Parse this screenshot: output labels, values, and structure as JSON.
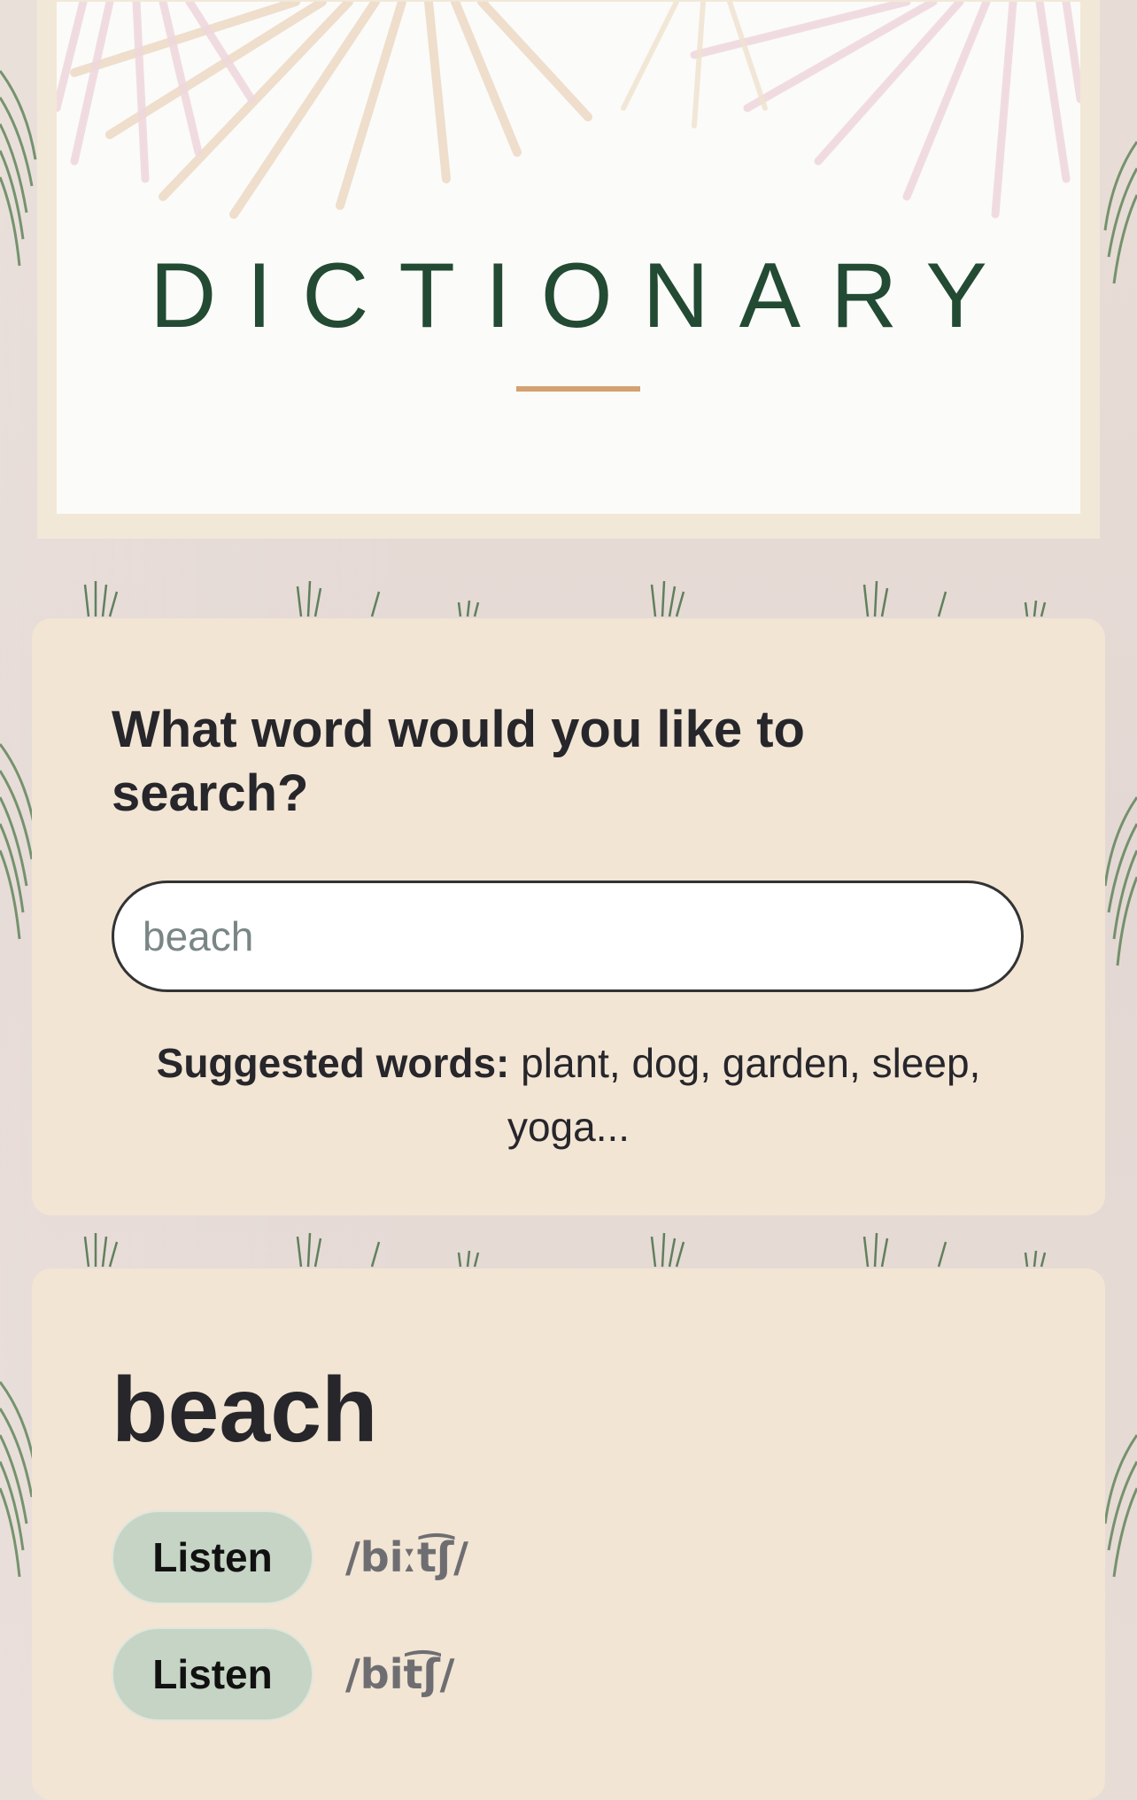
{
  "header": {
    "title": "DICTIONARY"
  },
  "search": {
    "question": "What word would you like to search?",
    "placeholder": "beach",
    "suggested_label": "Suggested words:",
    "suggested_words": "plant, dog, garden, sleep, yoga..."
  },
  "result": {
    "word": "beach",
    "phonetics": [
      {
        "button_label": "Listen",
        "text": "/biːt͡ʃ/"
      },
      {
        "button_label": "Listen",
        "text": "/bit͡ʃ/"
      }
    ]
  },
  "colors": {
    "title": "#234a33",
    "accent_underline": "#d4a170",
    "card_bg": "#f2e5d4",
    "listen_button": "#c5d4c4"
  },
  "icons": [
    "palm-frond-decor",
    "grass-tuft-decor"
  ]
}
